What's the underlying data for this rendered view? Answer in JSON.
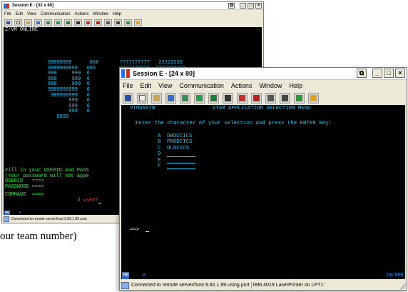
{
  "caption": "our team number)",
  "back_window": {
    "title": "Session E - [32 x 80]",
    "menu": [
      "File",
      "Edit",
      "View",
      "Communication",
      "Actions",
      "Window",
      "Help"
    ],
    "screen": {
      "header": "Z/VM ONLINE",
      "logo_lines": [
        "99999999      666       7777777777   22222222",
        "9999999999   666        7777777777  2222222222",
        "999     999  6",
        "999     999  6",
        "999     999  6",
        "9999999999   6",
        " 999999999   6",
        "       999   6",
        "       999   6",
        "       999   6",
        "   9999       "
      ],
      "prompt_lines": [
        "Fill in your USERID and PASS",
        "(Your password will not appe",
        "USERID   ===>",
        "PASSWORD ===>"
      ],
      "command_label": "COMMAND  ===>",
      "command_value": "d vse27"
    },
    "oia": {
      "indicator": "MB",
      "session": "e"
    },
    "status": "Connected to remote server/host 9.82.1.89 usin"
  },
  "front_window": {
    "title": "Session E - [24 x 80]",
    "menu": [
      "File",
      "Edit",
      "View",
      "Communication",
      "Actions",
      "Window",
      "Help"
    ],
    "screen": {
      "left_id": "VTMUSSTB",
      "header": "VTAM APPLICATION SELECTION MENU",
      "instruction": "Enter the character of your selection and press the ENTER key:",
      "options": [
        {
          "key": "A",
          "label": "DBDCCICS"
        },
        {
          "key": "B",
          "label": "PRODCICS"
        },
        {
          "key": "C",
          "label": "OLDCICS"
        },
        {
          "key": "D",
          "label": ""
        },
        {
          "key": "E",
          "label": ""
        },
        {
          "key": "F",
          "label": ""
        }
      ],
      "input_prompt": "==>"
    },
    "oia": {
      "indicator": "MB",
      "session": "e",
      "cursor_pos": "19/008"
    },
    "status": {
      "connection": "Connected to remote server/host 9.82.1.89 using port",
      "printer": "IBM 4019 LaserPrinter on LPT1:"
    }
  },
  "colors": {
    "screen_bg": "#000000",
    "green": "#2ee84c",
    "cyan": "#31c4f2",
    "white": "#e8e8e8",
    "oia_blue": "#2f9bff"
  },
  "toolbar_icons": [
    "print-screen-icon",
    "copy-icon",
    "paste-icon",
    "send-icon",
    "receive-icon",
    "display-icon",
    "color-icon",
    "map-icon",
    "record-icon",
    "play-icon",
    "macro-icon",
    "keypad-icon",
    "help-icon",
    "quickstep-icon"
  ]
}
